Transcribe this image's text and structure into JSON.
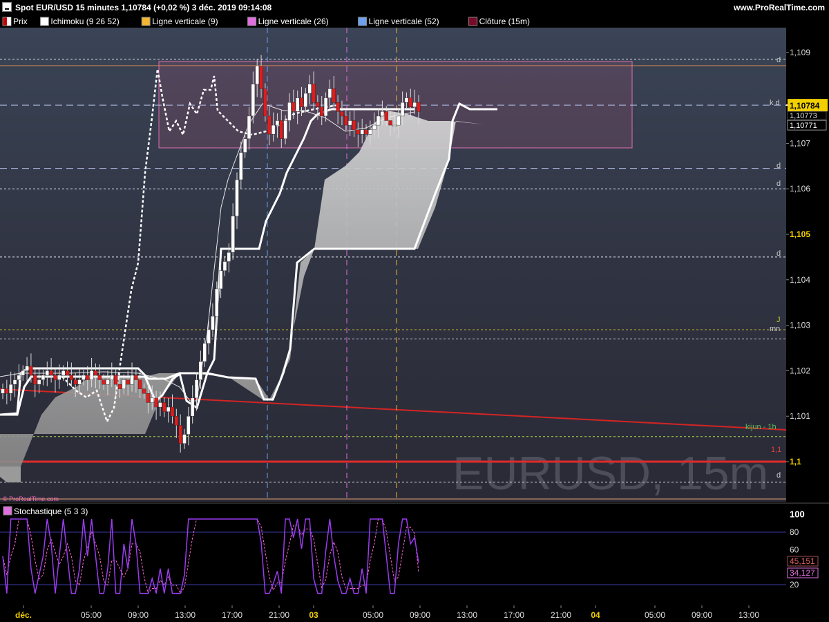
{
  "window": {
    "title": "Spot EUR/USD 15 minutes 1,10784 (+0,02 %) 3 déc. 2019 09:14:08",
    "url_label": "www.ProRealTime.com"
  },
  "legend": [
    {
      "label": "Prix",
      "color": "#cc0000",
      "style": "split"
    },
    {
      "label": "Ichimoku (9 26 52)",
      "color": "#ffffff"
    },
    {
      "label": "Ligne verticale (9)",
      "color": "#f2b632"
    },
    {
      "label": "Ligne verticale (26)",
      "color": "#e070e0"
    },
    {
      "label": "Ligne verticale (52)",
      "color": "#6fa0ee"
    },
    {
      "label": "Clôture (15m)",
      "color": "#7a0a2a"
    }
  ],
  "watermark": "EURUSD, 15m",
  "watermark_small": "© ProRealTime.com",
  "price_axis": {
    "ticks": [
      "1,109",
      "1,107",
      "1,106",
      "1,105",
      "1,104",
      "1,103",
      "1,102",
      "1,101",
      "1,1"
    ],
    "bold_ticks": [
      "1,105",
      "1,1"
    ],
    "current": "1,10784",
    "other_labels": [
      "1,10773",
      "1,10771"
    ]
  },
  "level_labels": {
    "d_top": "d",
    "kd": "k d",
    "d_1071": "d",
    "d_106": "d",
    "d_1045": "d",
    "j": "J",
    "mn": "mn",
    "kijun": "kijun - 1h",
    "red_11": "1,1",
    "d_bottom": "d"
  },
  "stochastic": {
    "title": "Stochastique (5 3 3)",
    "ticks": [
      "100",
      "80",
      "60",
      "20"
    ],
    "bold_ticks": [
      "100"
    ],
    "k_value": "45,151",
    "d_value": "34,127"
  },
  "time_axis": {
    "labels": [
      "déc.",
      "05:00",
      "09:00",
      "13:00",
      "17:00",
      "21:00",
      "03",
      "05:00",
      "09:00",
      "13:00",
      "17:00",
      "21:00",
      "04",
      "05:00",
      "09:00",
      "13:00"
    ],
    "bold_labels": [
      "déc.",
      "03",
      "04"
    ]
  },
  "colors": {
    "accent_current_price": "#f2d000",
    "rectangle": "#e070b0",
    "red_line": "#dd2222",
    "stoch_k": "#e060e0",
    "stoch_d": "#ff66cc"
  },
  "chart_data": {
    "type": "candlestick",
    "instrument": "Spot EUR/USD",
    "timeframe": "15 minutes",
    "y_range": [
      1.1,
      1.109
    ],
    "price_levels": {
      "rect_top": 1.1088,
      "rect_bottom": 1.1069,
      "current": 1.10784,
      "d_1064": 1.10645,
      "d_1060": 1.106,
      "d_1045": 1.1045,
      "j_1029": 1.1029,
      "mn_1027": 1.1027,
      "kijun_1h": 1.10055,
      "red_11": 1.1,
      "d_0995": 1.09955
    },
    "vertical_lines": [
      "1 déc. 20:00 (52)",
      "2 déc. 02:00 (26)",
      "3 déc. 07:00 (9)"
    ],
    "closes": [
      1.1016,
      1.1015,
      1.1017,
      1.1018,
      1.1019,
      1.102,
      1.1021,
      1.1019,
      1.1017,
      1.1018,
      1.1019,
      1.102,
      1.1019,
      1.1018,
      1.1019,
      1.102,
      1.1019,
      1.1018,
      1.1017,
      1.1018,
      1.1019,
      1.1018,
      1.102,
      1.1019,
      1.1018,
      1.1017,
      1.1018,
      1.1019,
      1.1017,
      1.1016,
      1.1018,
      1.1017,
      1.1019,
      1.1018,
      1.1016,
      1.1015,
      1.1013,
      1.1014,
      1.1012,
      1.1013,
      1.1011,
      1.1012,
      1.101,
      1.1008,
      1.1004,
      1.1006,
      1.101,
      1.1014,
      1.1018,
      1.1022,
      1.1026,
      1.1029,
      1.1032,
      1.1038,
      1.1042,
      1.1044,
      1.1046,
      1.1054,
      1.1062,
      1.1068,
      1.1071,
      1.1076,
      1.1083,
      1.1087,
      1.1082,
      1.1076,
      1.1072,
      1.1074,
      1.1075,
      1.1071,
      1.1075,
      1.1079,
      1.1077,
      1.108,
      1.1078,
      1.1081,
      1.1083,
      1.1079,
      1.1078,
      1.1076,
      1.108,
      1.1082,
      1.1079,
      1.1077,
      1.1076,
      1.1074,
      1.1075,
      1.1073,
      1.1072,
      1.1073,
      1.1072,
      1.1073,
      1.1074,
      1.1076,
      1.1077,
      1.1075,
      1.1074,
      1.1074,
      1.1076,
      1.1079,
      1.108,
      1.1078,
      1.1079,
      1.1077
    ],
    "stochastic": {
      "k_last": 45.151,
      "d_last": 34.127,
      "ylim": [
        0,
        100
      ],
      "guides": [
        80,
        20
      ]
    }
  }
}
